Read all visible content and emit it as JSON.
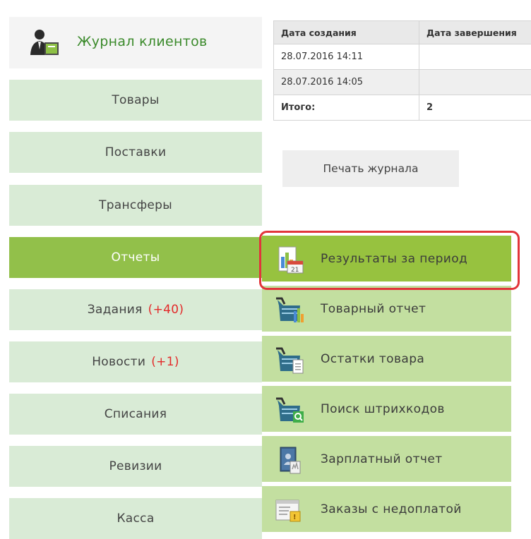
{
  "header": {
    "title": "Журнал клиентов"
  },
  "menu": {
    "items": [
      {
        "label": "Товары",
        "badge": ""
      },
      {
        "label": "Поставки",
        "badge": ""
      },
      {
        "label": "Трансферы",
        "badge": ""
      },
      {
        "label": "Отчеты",
        "badge": "",
        "active": true
      },
      {
        "label": "Задания",
        "badge": "(+40)"
      },
      {
        "label": "Новости",
        "badge": "(+1)"
      },
      {
        "label": "Списания",
        "badge": ""
      },
      {
        "label": "Ревизии",
        "badge": ""
      },
      {
        "label": "Касса",
        "badge": ""
      }
    ]
  },
  "table": {
    "headers": [
      "Дата создания",
      "Дата завершения"
    ],
    "rows": [
      [
        "28.07.2016 14:11",
        ""
      ],
      [
        "28.07.2016 14:05",
        ""
      ]
    ],
    "total": {
      "label": "Итого:",
      "value": "2"
    }
  },
  "print_button": "Печать журнала",
  "reports_submenu": {
    "items": [
      {
        "label": "Результаты за период",
        "icon": "calendar-chart-icon",
        "highlighted": true
      },
      {
        "label": "Товарный отчет",
        "icon": "basket-chart-icon"
      },
      {
        "label": "Остатки товара",
        "icon": "basket-document-icon"
      },
      {
        "label": "Поиск штрихкодов",
        "icon": "basket-search-icon"
      },
      {
        "label": "Зарплатный отчет",
        "icon": "salary-book-icon"
      },
      {
        "label": "Заказы с недоплатой",
        "icon": "orders-underpaid-icon"
      }
    ]
  },
  "colors": {
    "menu_bg": "#d9ebd6",
    "menu_active": "#92c04a",
    "submenu_bg": "#c3dfa0",
    "submenu_highlight": "#97c23f",
    "badge_red": "#e32a2a",
    "frame_red": "#e2353a"
  }
}
